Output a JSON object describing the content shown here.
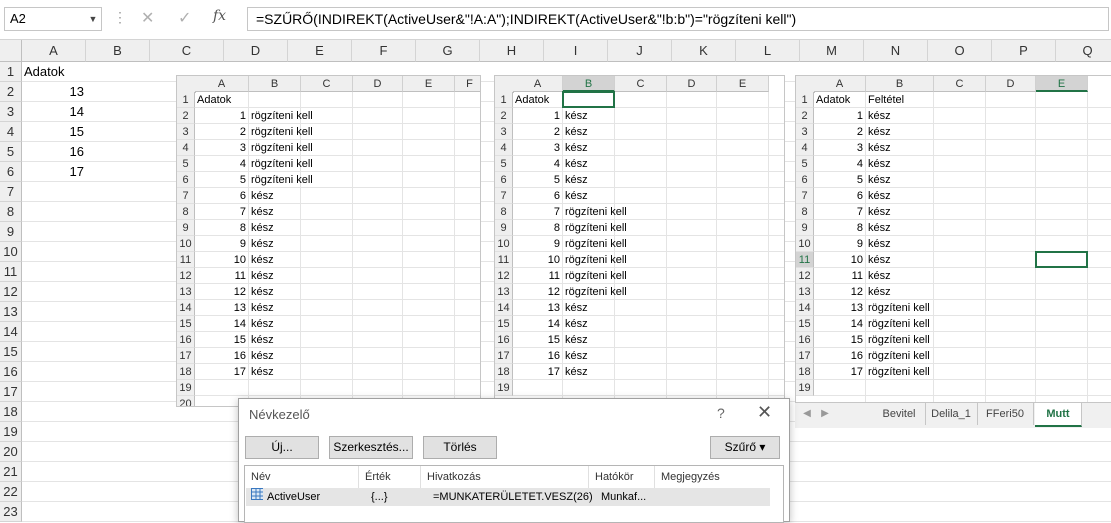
{
  "formula_bar": {
    "name_box": "A2",
    "formula": "=SZŰRŐ(INDIREKT(ActiveUser&\"!A:A\");INDIREKT(ActiveUser&\"!b:b\")=\"rögzíteni kell\")",
    "cancel_icon": "x-icon",
    "enter_icon": "check-icon",
    "fx_label": "fx"
  },
  "main_sheet": {
    "columns": [
      "A",
      "B",
      "C",
      "D",
      "E",
      "F",
      "G",
      "H",
      "I",
      "J",
      "K",
      "L",
      "M",
      "N",
      "O",
      "P",
      "Q"
    ],
    "rows": [
      "1",
      "2",
      "3",
      "4",
      "5",
      "6",
      "7",
      "8",
      "9",
      "10",
      "11",
      "12",
      "13",
      "14",
      "15",
      "16",
      "17",
      "18",
      "19",
      "20",
      "21",
      "22",
      "23"
    ],
    "header_text": "Adatok",
    "values": [
      "13",
      "14",
      "15",
      "16",
      "17"
    ]
  },
  "window1": {
    "columns": [
      "A",
      "B",
      "C",
      "D",
      "E",
      "F"
    ],
    "rows": [
      "1",
      "2",
      "3",
      "4",
      "5",
      "6",
      "7",
      "8",
      "9",
      "10",
      "11",
      "12",
      "13",
      "14",
      "15",
      "16",
      "17",
      "18",
      "19",
      "20"
    ],
    "header_a": "Adatok",
    "numbers": [
      "1",
      "2",
      "3",
      "4",
      "5",
      "6",
      "7",
      "8",
      "9",
      "10",
      "11",
      "12",
      "13",
      "14",
      "15",
      "16",
      "17"
    ],
    "status": [
      "rögzíteni kell",
      "rögzíteni kell",
      "rögzíteni kell",
      "rögzíteni kell",
      "rögzíteni kell",
      "kész",
      "kész",
      "kész",
      "kész",
      "kész",
      "kész",
      "kész",
      "kész",
      "kész",
      "kész",
      "kész",
      "kész"
    ]
  },
  "window2": {
    "columns": [
      "A",
      "B",
      "C",
      "D",
      "E"
    ],
    "rows": [
      "1",
      "2",
      "3",
      "4",
      "5",
      "6",
      "7",
      "8",
      "9",
      "10",
      "11",
      "12",
      "13",
      "14",
      "15",
      "16",
      "17",
      "18",
      "19"
    ],
    "header_a": "Adatok",
    "numbers": [
      "1",
      "2",
      "3",
      "4",
      "5",
      "6",
      "7",
      "8",
      "9",
      "10",
      "11",
      "12",
      "13",
      "14",
      "15",
      "16",
      "17"
    ],
    "status": [
      "kész",
      "kész",
      "kész",
      "kész",
      "kész",
      "kész",
      "rögzíteni kell",
      "rögzíteni kell",
      "rögzíteni kell",
      "rögzíteni kell",
      "rögzíteni kell",
      "rögzíteni kell",
      "kész",
      "kész",
      "kész",
      "kész",
      "kész"
    ]
  },
  "window3": {
    "columns": [
      "A",
      "B",
      "C",
      "D",
      "E"
    ],
    "rows": [
      "1",
      "2",
      "3",
      "4",
      "5",
      "6",
      "7",
      "8",
      "9",
      "10",
      "11",
      "12",
      "13",
      "14",
      "15",
      "16",
      "17",
      "18",
      "19"
    ],
    "header_a": "Adatok",
    "header_b": "Feltétel",
    "numbers": [
      "1",
      "2",
      "3",
      "4",
      "5",
      "6",
      "7",
      "8",
      "9",
      "10",
      "11",
      "12",
      "13",
      "14",
      "15",
      "16",
      "17"
    ],
    "status": [
      "kész",
      "kész",
      "kész",
      "kész",
      "kész",
      "kész",
      "kész",
      "kész",
      "kész",
      "kész",
      "kész",
      "kész",
      "rögzíteni kell",
      "rögzíteni kell",
      "rögzíteni kell",
      "rögzíteni kell",
      "rögzíteni kell"
    ],
    "tabs": [
      "Bevitel",
      "Delila_1",
      "FFeri50",
      "Mutt"
    ],
    "active_tab": "Mutt"
  },
  "dialog": {
    "title": "Névkezelő",
    "help": "?",
    "close": "✕",
    "buttons": {
      "new": "Új...",
      "edit": "Szerkesztés...",
      "delete": "Törlés",
      "filter": "Szűrő ▾"
    },
    "list_headers": [
      "Név",
      "Érték",
      "Hivatkozás",
      "Hatókör",
      "Megjegyzés"
    ],
    "row": {
      "name": "ActiveUser",
      "value": "{...}",
      "reference": "=MUNKATERÜLETET.VESZ(26)",
      "scope": "Munkaf...",
      "comment": ""
    }
  }
}
